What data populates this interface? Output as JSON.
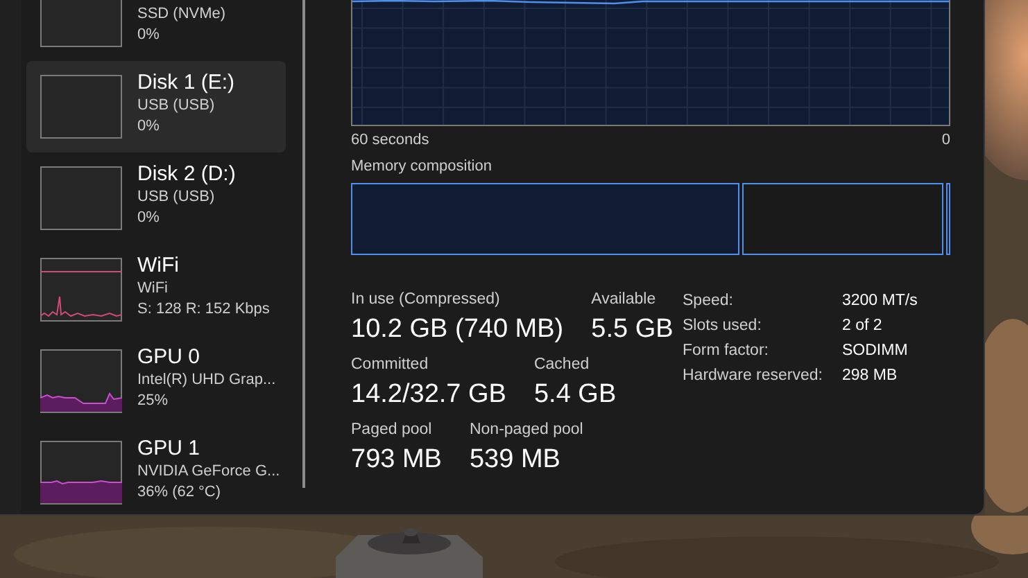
{
  "sidebar": {
    "items": [
      {
        "kind": "disk",
        "subtitle": "SSD (NVMe)",
        "value": "0%",
        "selected": false
      },
      {
        "kind": "disk",
        "title": "Disk 1 (E:)",
        "subtitle": "USB (USB)",
        "value": "0%",
        "selected": true
      },
      {
        "kind": "disk",
        "title": "Disk 2 (D:)",
        "subtitle": "USB (USB)",
        "value": "0%",
        "selected": false
      },
      {
        "kind": "network",
        "title": "WiFi",
        "subtitle": "WiFi",
        "value": "S: 128 R: 152 Kbps",
        "selected": false
      },
      {
        "kind": "gpu",
        "title": "GPU 0",
        "subtitle": "Intel(R) UHD Grap...",
        "value": "25%",
        "selected": false
      },
      {
        "kind": "gpu",
        "title": "GPU 1",
        "subtitle": "NVIDIA GeForce G...",
        "value": "36%  (62 °C)",
        "selected": false
      }
    ]
  },
  "memory_graph": {
    "time_label": "60 seconds",
    "end_label": "0"
  },
  "composition": {
    "title": "Memory composition",
    "segments": [
      {
        "kind": "filled",
        "level": 0.655
      },
      {
        "kind": "outlined",
        "level": 0.34
      },
      {
        "kind": "outlined",
        "level": 0.005
      }
    ]
  },
  "stats": [
    [
      {
        "label": "In use (Compressed)",
        "value": "10.2 GB (740 MB)"
      },
      {
        "label": "Available",
        "value": "5.5 GB"
      }
    ],
    [
      {
        "label": "Committed",
        "value": "14.2/32.7 GB"
      },
      {
        "label": "Cached",
        "value": "5.4 GB"
      }
    ],
    [
      {
        "label": "Paged pool",
        "value": "793 MB"
      },
      {
        "label": "Non-paged pool",
        "value": "539 MB"
      }
    ]
  ],
  "specs": [
    {
      "label": "Speed:",
      "value": "3200 MT/s"
    },
    {
      "label": "Slots used:",
      "value": "2 of 2"
    },
    {
      "label": "Form factor:",
      "value": "SODIMM"
    },
    {
      "label": "Hardware reserved:",
      "value": "298 MB"
    }
  ]
}
